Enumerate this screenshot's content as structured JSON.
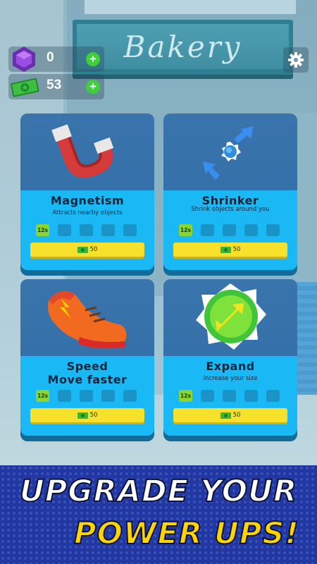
{
  "store": {
    "sign_text": "Bakery"
  },
  "currency": {
    "gems": {
      "icon": "gem-icon",
      "value": "0"
    },
    "cash": {
      "icon": "cash-icon",
      "value": "53"
    }
  },
  "settings": {
    "icon": "gear-icon"
  },
  "powerups": [
    {
      "name": "Magnetism",
      "description": "Attracts nearby objects",
      "icon": "magnet-icon",
      "level_label": "12s",
      "levels_total": 5,
      "price": "50"
    },
    {
      "name": "Shrinker",
      "description": "Shrink objects around you",
      "icon": "shrink-arrows-icon",
      "level_label": "12s",
      "levels_total": 5,
      "price": "50"
    },
    {
      "name": "Speed",
      "description": "Move faster",
      "icon": "sneaker-icon",
      "level_label": "12s",
      "levels_total": 5,
      "price": "50"
    },
    {
      "name": "Expand",
      "description": "Increase your size",
      "icon": "expand-arrows-icon",
      "level_label": "12s",
      "levels_total": 5,
      "price": "50"
    }
  ],
  "banner": {
    "line1": "UPGRADE YOUR",
    "line2": "POWER UPS!"
  },
  "colors": {
    "card_header": "#3470a9",
    "card_body": "#1ab8f5",
    "price_button": "#f7e12a",
    "banner_bg": "#2237a0",
    "banner_accent": "#ffd400"
  }
}
